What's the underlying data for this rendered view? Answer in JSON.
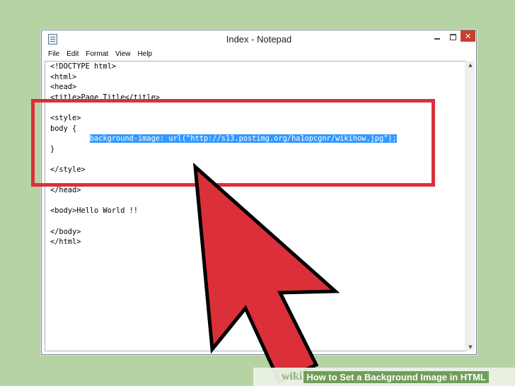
{
  "window": {
    "title": "Index - Notepad",
    "close_label": "✕"
  },
  "menu": [
    "File",
    "Edit",
    "Format",
    "View",
    "Help"
  ],
  "editor": {
    "lines": [
      "<!DOCTYPE html>",
      "<html>",
      "<head>",
      "<title>Page Title</title>",
      "",
      "<style>",
      "body {",
      "         ",
      "}",
      "",
      "</style>",
      "",
      "</head>",
      "",
      "<body>Hello World !!",
      "",
      "</body>",
      "</html>"
    ],
    "selected_text": "background-image: url(\"http://s13.postimg.org/ha1opcgnr/wikihow.jpg\");"
  },
  "scrollbar": {
    "up": "▲",
    "down": "▼"
  },
  "footer": {
    "logo": "wiki",
    "caption": "How to Set a Background Image in HTML"
  },
  "colors": {
    "background": "#b6d3a4",
    "highlight_red": "#d8313c",
    "arrow_red": "#db2f3a",
    "selection": "#3399ff",
    "close_button": "#c7402e"
  }
}
